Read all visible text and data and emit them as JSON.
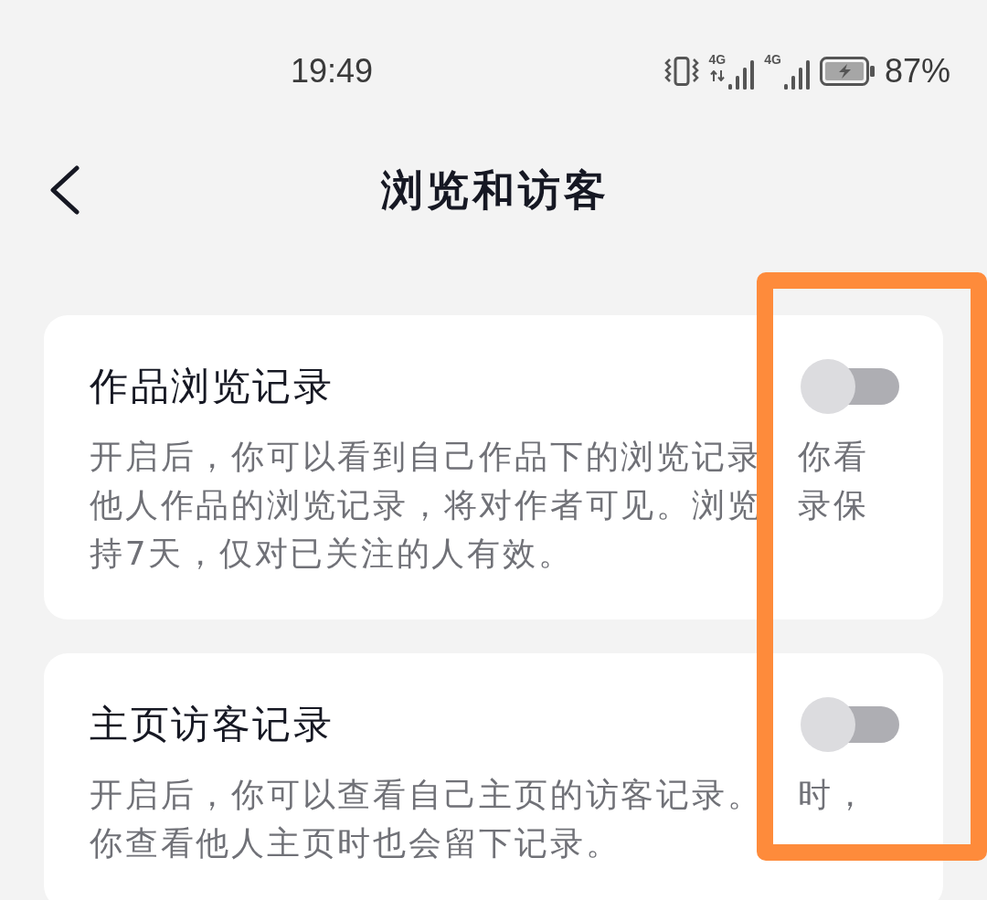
{
  "status_bar": {
    "time": "19:49",
    "signals": [
      {
        "network": "4G",
        "activity": true
      },
      {
        "network": "4G",
        "activity": false
      }
    ],
    "battery": "87%"
  },
  "header": {
    "title": "浏览和访客"
  },
  "settings": [
    {
      "title": "作品浏览记录",
      "description": "开启后，你可以看到自己作品下的浏览记录　你看他人作品的浏览记录，将对作者可见。浏览　录保持7天，仅对已关注的人有效。",
      "on": false
    },
    {
      "title": "主页访客记录",
      "description": "开启后，你可以查看自己主页的访客记录。　时，你查看他人主页时也会留下记录。",
      "on": false
    }
  ]
}
